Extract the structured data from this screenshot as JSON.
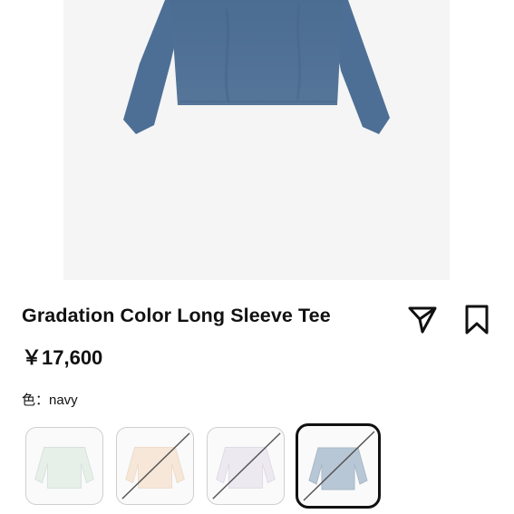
{
  "product": {
    "title": "Gradation Color Long Sleeve Tee",
    "price": "￥17,600",
    "color_label": "色：navy",
    "image_color": "#4f6f92"
  },
  "actions": {
    "share_icon": "share-icon",
    "bookmark_icon": "bookmark-icon"
  },
  "swatches": [
    {
      "color": "#e6eee9",
      "sold_out": false
    },
    {
      "color": "#f5e6d8",
      "sold_out": true
    },
    {
      "color": "#ece8f0",
      "sold_out": true
    },
    {
      "color": "#b7c6d4",
      "sold_out": true,
      "selected": true
    }
  ]
}
